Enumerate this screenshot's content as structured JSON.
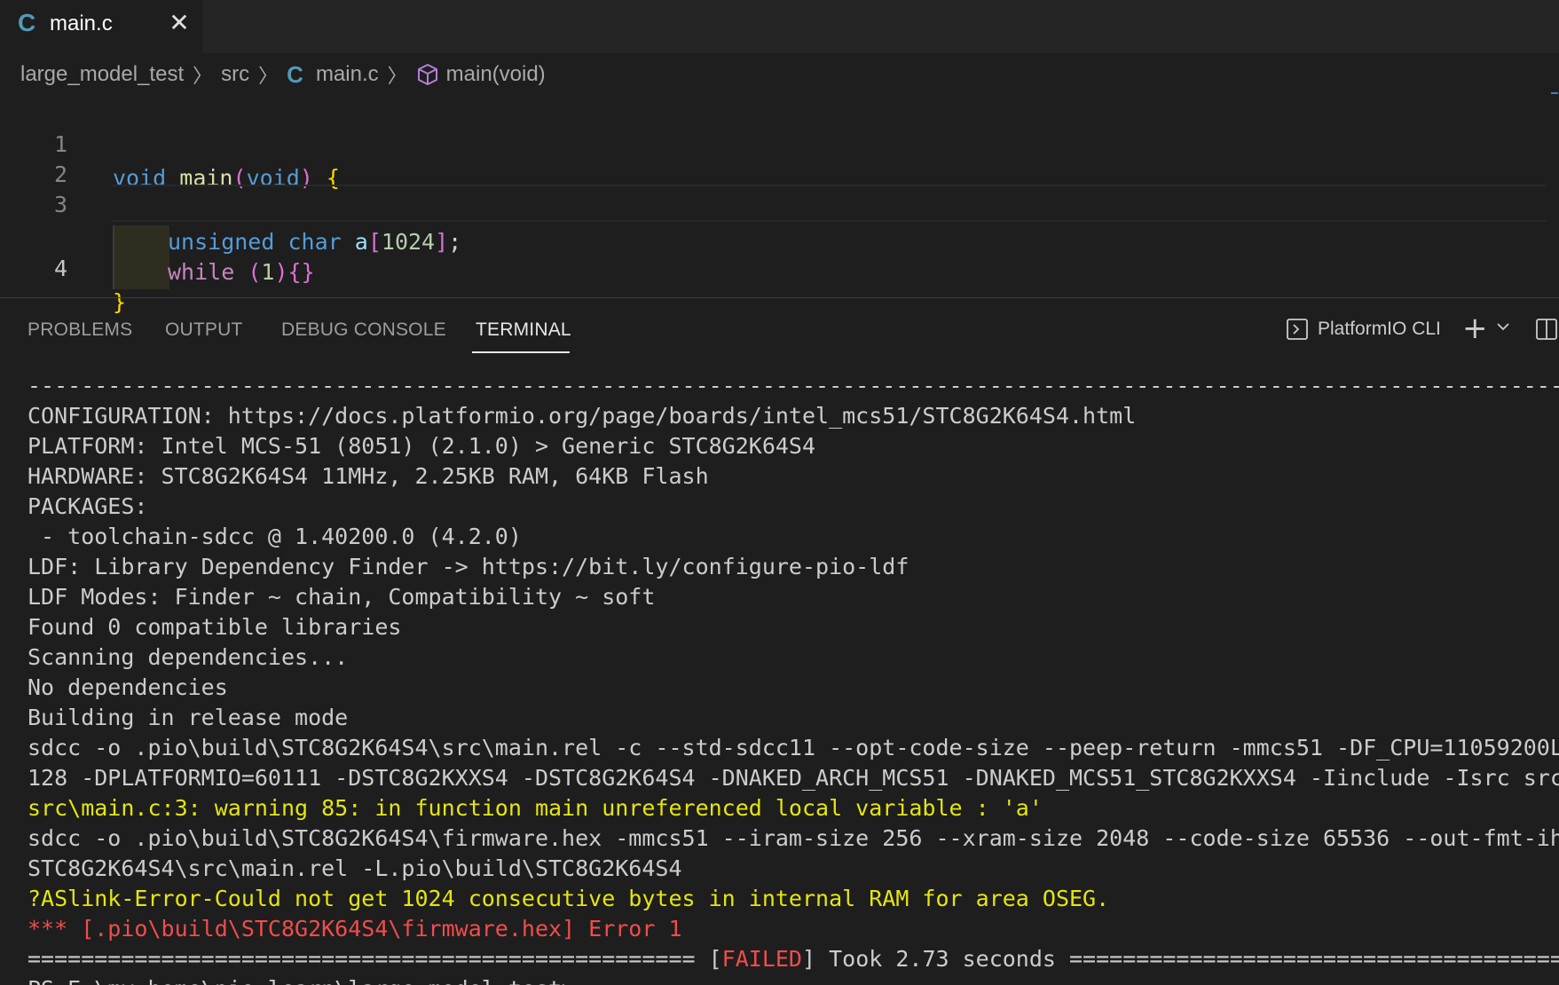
{
  "tab": {
    "icon": "C",
    "label": "main.c",
    "close": "✕"
  },
  "breadcrumb": {
    "folder": "large_model_test",
    "src": "src",
    "file_icon": "C",
    "file": "main.c",
    "symbol": "main(void)"
  },
  "editor": {
    "lines": [
      {
        "num": "1",
        "tokens": [
          {
            "t": "void",
            "c": "kw"
          },
          {
            "t": " ",
            "c": "punc"
          },
          {
            "t": "main",
            "c": "fn"
          },
          {
            "t": "(",
            "c": "b2"
          },
          {
            "t": "void",
            "c": "kw"
          },
          {
            "t": ")",
            "c": "b2"
          },
          {
            "t": " ",
            "c": "punc"
          },
          {
            "t": "{",
            "c": "b1"
          }
        ]
      },
      {
        "num": "2",
        "tokens": [
          {
            "t": "unsigned",
            "c": "kw"
          },
          {
            "t": " ",
            "c": "punc"
          },
          {
            "t": "char",
            "c": "kw"
          },
          {
            "t": " ",
            "c": "punc"
          },
          {
            "t": "a",
            "c": "var"
          },
          {
            "t": "[",
            "c": "b2"
          },
          {
            "t": "1024",
            "c": "num"
          },
          {
            "t": "]",
            "c": "b2"
          },
          {
            "t": ";",
            "c": "punc"
          }
        ]
      },
      {
        "num": "3",
        "tokens": [
          {
            "t": "while",
            "c": "ctrl"
          },
          {
            "t": " ",
            "c": "punc"
          },
          {
            "t": "(",
            "c": "b2"
          },
          {
            "t": "1",
            "c": "num"
          },
          {
            "t": ")",
            "c": "b2"
          },
          {
            "t": "{",
            "c": "b2"
          },
          {
            "t": "}",
            "c": "b2"
          }
        ]
      },
      {
        "num": "4",
        "tokens": [
          {
            "t": "}",
            "c": "b1"
          }
        ]
      }
    ]
  },
  "panel": {
    "tabs": [
      "PROBLEMS",
      "OUTPUT",
      "DEBUG CONSOLE",
      "TERMINAL"
    ],
    "active_tab": "TERMINAL",
    "terminal_name": "PlatformIO CLI"
  },
  "terminal": {
    "lines": [
      [
        {
          "t": "----------------------------------------------------------------------------------------------------------------------------------"
        }
      ],
      [
        {
          "t": "CONFIGURATION: https://docs.platformio.org/page/boards/intel_mcs51/STC8G2K64S4.html"
        }
      ],
      [
        {
          "t": "PLATFORM: Intel MCS-51 (8051) (2.1.0) > Generic STC8G2K64S4"
        }
      ],
      [
        {
          "t": "HARDWARE: STC8G2K64S4 11MHz, 2.25KB RAM, 64KB Flash"
        }
      ],
      [
        {
          "t": "PACKAGES:"
        }
      ],
      [
        {
          "t": " - toolchain-sdcc @ 1.40200.0 (4.2.0)"
        }
      ],
      [
        {
          "t": "LDF: Library Dependency Finder -> https://bit.ly/configure-pio-ldf"
        }
      ],
      [
        {
          "t": "LDF Modes: Finder ~ chain, Compatibility ~ soft"
        }
      ],
      [
        {
          "t": "Found 0 compatible libraries"
        }
      ],
      [
        {
          "t": "Scanning dependencies..."
        }
      ],
      [
        {
          "t": "No dependencies"
        }
      ],
      [
        {
          "t": "Building in release mode"
        }
      ],
      [
        {
          "t": "sdcc -o .pio\\build\\STC8G2K64S4\\src\\main.rel -c --std-sdcc11 --opt-code-size --peep-return -mmcs51 -DF_CPU=11059200L"
        }
      ],
      [
        {
          "t": "128 -DPLATFORMIO=60111 -DSTC8G2KXXS4 -DSTC8G2K64S4 -DNAKED_ARCH_MCS51 -DNAKED_MCS51_STC8G2KXXS4 -Iinclude -Isrc src"
        }
      ],
      [
        {
          "t": "src\\main.c:3: warning 85: in function main unreferenced local variable : 'a'",
          "c": "yellow"
        }
      ],
      [
        {
          "t": "sdcc -o .pio\\build\\STC8G2K64S4\\firmware.hex -mmcs51 --iram-size 256 --xram-size 2048 --code-size 65536 --out-fmt-ih"
        }
      ],
      [
        {
          "t": "STC8G2K64S4\\src\\main.rel -L.pio\\build\\STC8G2K64S4"
        }
      ],
      [
        {
          "t": "?ASlink-Error-Could not get 1024 consecutive bytes in internal RAM for area OSEG.",
          "c": "yellow"
        }
      ],
      [
        {
          "t": "*** [.pio\\build\\STC8G2K64S4\\firmware.hex] Error 1",
          "c": "red"
        }
      ],
      [
        {
          "t": "================================================== ["
        },
        {
          "t": "FAILED",
          "c": "red"
        },
        {
          "t": "] Took 2.73 seconds =========================================="
        }
      ],
      [
        {
          "t": "PS E:\\my_home\\pio_learn\\large_model_test> "
        }
      ]
    ]
  },
  "colors": {
    "background": "#1e1e1e",
    "accent": "#519aba",
    "warning": "#e5e510",
    "error": "#f14c4c"
  }
}
